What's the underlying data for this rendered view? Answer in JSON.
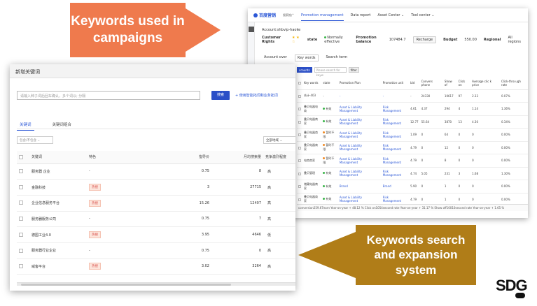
{
  "callouts": {
    "top": "Keywords used in campaigns",
    "bottom": "Keywords search and expansion system"
  },
  "campaign_window": {
    "brand": "百度营销",
    "brand_sub": "搜索推广",
    "nav": [
      "Promotion management",
      "Data report",
      "Asset Center ⌄",
      "Tool center ⌄"
    ],
    "account_label": "Account:shbvip-haoke",
    "customer_rights": "Customer Rights",
    "state_label": "state",
    "state_value": "Normally effective",
    "promotion_balance_label": "Promotion balance",
    "promotion_balance_value": "107484.7",
    "recharge": "Recharge",
    "budget_label": "Budget",
    "budget_value": "550.00",
    "regional_label": "Regional",
    "regional_value": "All regions",
    "tabs": [
      "Account over",
      "Key words",
      "Search term"
    ],
    "search_placeholder": "Please search for keyw",
    "filter_label": "filter",
    "add_button": "ccounts",
    "columns": [
      "Key words",
      "state",
      "Promotion Plan",
      "Promotion unit",
      "bid",
      "Convers phone",
      "Show of",
      "Click on",
      "Average clic k price",
      "Click-thro ugh rate"
    ],
    "rows": [
      [
        "合计-403",
        "-",
        "-",
        "-",
        "-",
        "24330",
        "10617",
        "97",
        "2.33",
        "0.07%"
      ],
      [
        "叠贝电器电商",
        "有效",
        "Asset & Liability Management",
        "Risk Management",
        "4.61",
        "4.37",
        "294",
        "4",
        "1.14",
        "1.36%"
      ],
      [
        "叠贝电器商家",
        "有效",
        "Asset & Liability Management",
        "Risk Management",
        "12.77",
        "55.64",
        "3870",
        "13",
        "4.30",
        "0.34%"
      ],
      [
        "叠贝电器商家",
        "暂时不限",
        "Asset & Liability Management",
        "Risk Management",
        "1.09",
        "0",
        "64",
        "0",
        "0",
        "0.00%"
      ],
      [
        "叠贝电器商家",
        "暂时不限",
        "Asset & Liability Management",
        "Risk Management",
        "4.79",
        "0",
        "12",
        "0",
        "0",
        "0.00%"
      ],
      [
        "电商商家",
        "暂时不限",
        "Asset & Liability Management",
        "Risk Management",
        "4.79",
        "0",
        "8",
        "0",
        "0",
        "0.00%"
      ],
      [
        "叠贝管理",
        "有效",
        "Asset & Liability Management",
        "Risk Management",
        "4.74",
        "5.05",
        "231",
        "3",
        "1.68",
        "1.30%"
      ],
      [
        "储藏电器商家",
        "有效",
        "Brand",
        "Brand",
        "5.90",
        "0",
        "1",
        "0",
        "0",
        "0.00%"
      ],
      [
        "叠贝电器商家",
        "有效",
        "Asset & Liability Management",
        "Risk Management",
        "4.79",
        "0",
        "1",
        "0",
        "0",
        "0.00%"
      ]
    ],
    "footer": "conversion259.67earn  Year-on-year ↑ 48.12 %  Click on1054second rate  Year-on-year ↑ 31.17 %  Show off10010second rate  Year-on-year ↑ 1.65 %"
  },
  "keyword_window": {
    "title": "新增关键词",
    "search_placeholder": "请输入种子词后回车确认，多个词以; 分隔",
    "search_button": "搜索",
    "search_link": "+ 使用智能拓词和业务拓词",
    "tabs": [
      "关键词",
      "关键词组合"
    ],
    "filter_placeholder": "包含/不包含",
    "region_select": "全部地域",
    "columns": [
      "关键词",
      "特色",
      "指导价",
      "月均搜索量",
      "竞争激烈程度"
    ],
    "rows": [
      {
        "keyword": "服务器 企业",
        "tag": "-",
        "price": "0.75",
        "volume": "8",
        "competition": "高"
      },
      {
        "keyword": "金融科技",
        "tag": "热搜",
        "price": "3",
        "volume": "27715",
        "competition": "高"
      },
      {
        "keyword": "企业信息服务平台",
        "tag": "热搜",
        "price": "15.26",
        "volume": "12407",
        "competition": "高"
      },
      {
        "keyword": "服务器服务公司",
        "tag": "-",
        "price": "0.75",
        "volume": "7",
        "competition": "高"
      },
      {
        "keyword": "德国工业4.0",
        "tag": "热搜",
        "price": "3.95",
        "volume": "4646",
        "competition": "低"
      },
      {
        "keyword": "服务器行业企业",
        "tag": "-",
        "price": "0.75",
        "volume": "0",
        "competition": "高"
      },
      {
        "keyword": "威客平台",
        "tag": "热搜",
        "price": "3.02",
        "volume": "3264",
        "competition": "高"
      }
    ]
  },
  "logo": "SDG"
}
